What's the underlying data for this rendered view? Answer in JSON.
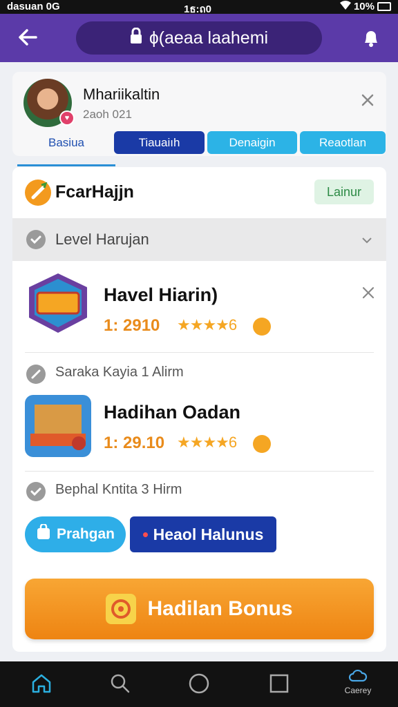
{
  "status_bar": {
    "carrier": "dasuan 0G",
    "time": "1ธ:ถ0",
    "battery": "10%"
  },
  "top_bar": {
    "url": "ɸ(aeaa laahemi"
  },
  "profile": {
    "name": "Mhariikaltin",
    "subtitle": "2aoh 021",
    "tabs": [
      "Basiua",
      "Tiauaiıh",
      "Denaigin",
      "Reaotlan"
    ]
  },
  "section": {
    "title": "FcarHajjn",
    "badge": "Lainur"
  },
  "level_row": {
    "label": "Level Harujan"
  },
  "games": [
    {
      "name": "Havel Hiarin)",
      "rating": "1: 2910",
      "stars": "★★★★",
      "extra": "6"
    },
    {
      "name": "Hadihan Oadan",
      "rating": "1: 29.10",
      "stars": "★★★★",
      "extra": "6"
    }
  ],
  "meta_rows": [
    {
      "label": "Saraka Kayia 1 Alirm"
    },
    {
      "label": "Bephal Kntita 3 Hirm"
    }
  ],
  "actions": {
    "button_a": "Prahgan",
    "button_b": "Heaol Halunus"
  },
  "bonus": {
    "label": "Hadilan Bonus"
  },
  "nav": {
    "last_label": "Caerey"
  },
  "colors": {
    "header": "#5b3aa8",
    "primary_blue": "#1a3aa6",
    "light_blue": "#2cb3e6",
    "accent_orange": "#f39a1e"
  }
}
